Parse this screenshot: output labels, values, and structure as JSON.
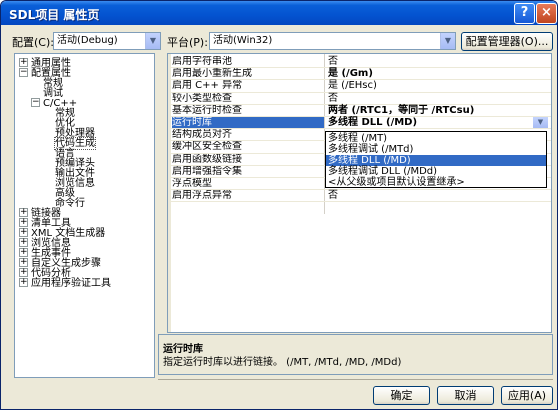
{
  "window": {
    "title": "SDL项目 属性页",
    "help_label": "?",
    "close_label": "×"
  },
  "toolbar": {
    "config_label": "配置(C):",
    "config_value": "活动(Debug)",
    "platform_label": "平台(P):",
    "platform_value": "活动(Win32)",
    "config_manager_label": "配置管理器(O)..."
  },
  "tree": {
    "items": [
      {
        "label": "通用属性",
        "expander": "+"
      },
      {
        "label": "配置属性",
        "expander": "−"
      },
      {
        "label": "常规",
        "expander": ""
      },
      {
        "label": "调试",
        "expander": ""
      },
      {
        "label": "C/C++",
        "expander": "−"
      },
      {
        "label": "常规",
        "expander": ""
      },
      {
        "label": "优化",
        "expander": ""
      },
      {
        "label": "预处理器",
        "expander": ""
      },
      {
        "label": "代码生成",
        "expander": ""
      },
      {
        "label": "语言",
        "expander": ""
      },
      {
        "label": "预编译头",
        "expander": ""
      },
      {
        "label": "输出文件",
        "expander": ""
      },
      {
        "label": "浏览信息",
        "expander": ""
      },
      {
        "label": "高级",
        "expander": ""
      },
      {
        "label": "命令行",
        "expander": ""
      },
      {
        "label": "链接器",
        "expander": "+"
      },
      {
        "label": "清单工具",
        "expander": "+"
      },
      {
        "label": "XML 文档生成器",
        "expander": "+"
      },
      {
        "label": "浏览信息",
        "expander": "+"
      },
      {
        "label": "生成事件",
        "expander": "+"
      },
      {
        "label": "自定义生成步骤",
        "expander": "+"
      },
      {
        "label": "代码分析",
        "expander": "+"
      },
      {
        "label": "应用程序验证工具",
        "expander": "+"
      }
    ],
    "selected_index": 8
  },
  "grid": {
    "rows": [
      {
        "key": "启用字符串池",
        "value": "否"
      },
      {
        "key": "启用最小重新生成",
        "value": "是 (/Gm)"
      },
      {
        "key": "启用 C++ 异常",
        "value": "是 (/EHsc)"
      },
      {
        "key": "较小类型检查",
        "value": "否"
      },
      {
        "key": "基本运行时检查",
        "value": "两者 (/RTC1，等同于 /RTCsu)"
      },
      {
        "key": "运行时库",
        "value": "多线程 DLL (/MD)"
      },
      {
        "key": "结构成员对齐",
        "value": ""
      },
      {
        "key": "缓冲区安全检查",
        "value": ""
      },
      {
        "key": "启用函数级链接",
        "value": ""
      },
      {
        "key": "启用增强指令集",
        "value": ""
      },
      {
        "key": "浮点模型",
        "value": ""
      },
      {
        "key": "启用浮点异常",
        "value": "否"
      }
    ],
    "selected_row": 5,
    "dropdown_options": [
      "多线程 (/MT)",
      "多线程调试 (/MTd)",
      "多线程 DLL (/MD)",
      "多线程调试 DLL (/MDd)",
      "<从父级或项目默认设置继承>"
    ],
    "dropdown_selected": 2
  },
  "description": {
    "title": "运行时库",
    "text": "指定运行时库以进行链接。   (/MT, /MTd, /MD, /MDd)"
  },
  "buttons": {
    "ok": "确定",
    "cancel": "取消",
    "apply": "应用(A)"
  },
  "colors": {
    "title_bar": "#0453d0",
    "selection": "#316ac5",
    "dialog_bg": "#ece9d8"
  }
}
